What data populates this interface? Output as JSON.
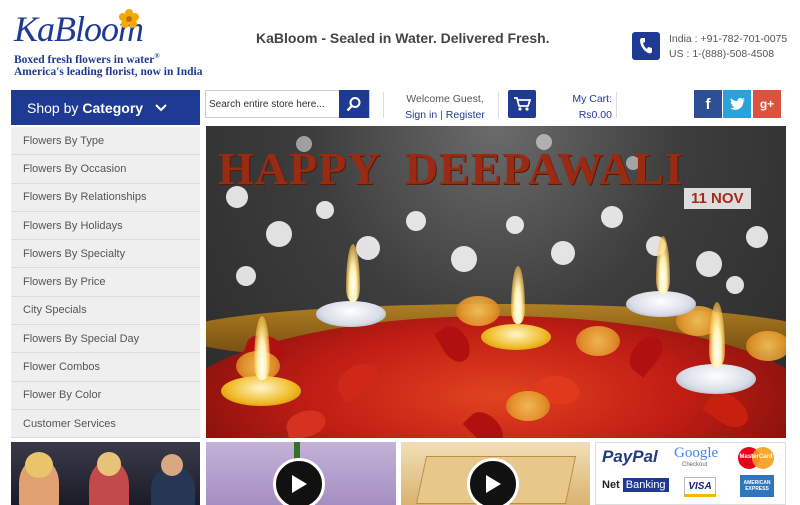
{
  "header": {
    "logo": {
      "name": "KaBloom",
      "subtitle1": "Boxed fresh flowers in water",
      "trademark": "®",
      "subtitle2": "America's leading florist, now in India"
    },
    "tagline": "KaBloom - Sealed in Water. Delivered Fresh.",
    "phones": {
      "india": "India : +91-782-701-0075",
      "us": "US : 1-(888)-508-4508"
    }
  },
  "nav": {
    "category_prefix": "Shop by",
    "category_label": "Category",
    "search": {
      "placeholder": "Search entire store here..."
    },
    "account": {
      "welcome": "Welcome Guest,",
      "sign_in": "Sign in",
      "divider": "|",
      "register": "Register"
    },
    "cart": {
      "label": "My Cart:",
      "amount": "Rs0.00"
    },
    "social": {
      "facebook": "f",
      "twitter": "t",
      "google": "g+"
    }
  },
  "menu": {
    "items": [
      "Flowers By Type",
      "Flowers By Occasion",
      "Flowers By Relationships",
      "Flowers By Holidays",
      "Flowers By Specialty",
      "Flowers By Price",
      "City Specials",
      "Flowers By Special Day",
      "Flower Combos",
      "Flower By Color",
      "Customer Services"
    ]
  },
  "banner": {
    "headline": "HAPPY  DEEPAWALI",
    "date": "11 NOV"
  },
  "payments": {
    "paypal": "PayPal",
    "google": "Google",
    "google_sub": "Checkout",
    "mastercard": "MasterCard",
    "netbanking_prefix": "Net",
    "netbanking": "Banking",
    "visa": "VISA",
    "amex": "AMERICAN EXPRESS"
  },
  "colors": {
    "brand": "#1f3a93",
    "facebook": "#2c4f95",
    "twitter": "#2ba2d9",
    "google": "#d9533e"
  }
}
